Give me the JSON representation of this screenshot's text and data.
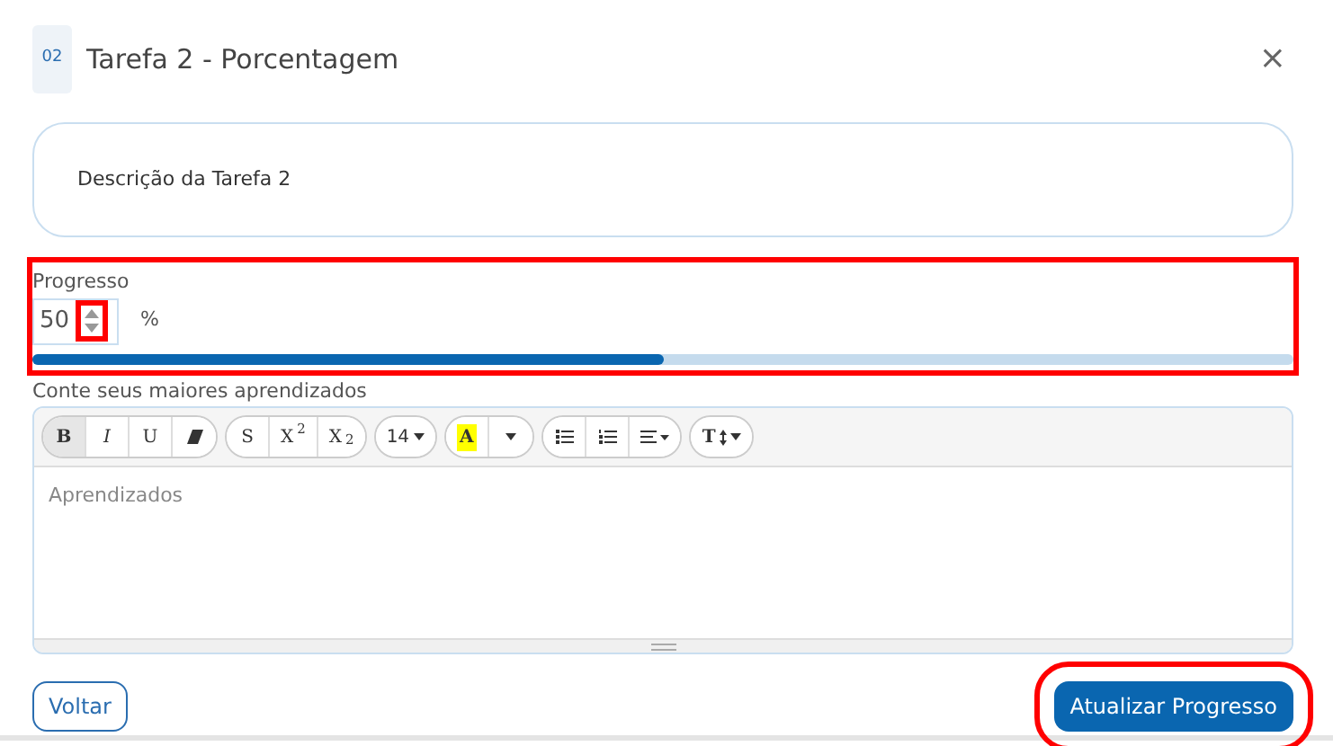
{
  "header": {
    "number": "02",
    "title": "Tarefa 2 - Porcentagem",
    "close": "×"
  },
  "description": "Descrição da Tarefa 2",
  "progress": {
    "label": "Progresso",
    "value": "50",
    "unit": "%",
    "level": 0.5,
    "highlighted": true,
    "spinner_highlighted": true
  },
  "learnings": {
    "label": "Conte seus maiores aprendizados",
    "placeholder": "Aprendizados",
    "toolbar": [
      [
        {
          "kind": "text",
          "label": "**B**",
          "selected": true
        },
        {
          "kind": "text",
          "label": "*I*",
          "selected": false
        },
        {
          "kind": "text",
          "label": "U",
          "selected": false
        },
        {
          "kind": "eraser",
          "selected": false
        }
      ],
      [
        {
          "kind": "text",
          "label": "S",
          "selected": false
        },
        {
          "kind": "text",
          "label": "X$^{2}$",
          "selected": false
        },
        {
          "kind": "text",
          "label": "X$_{2}$",
          "selected": false
        }
      ],
      [
        {
          "kind": "dropdown",
          "label": "14",
          "selected": false
        }
      ],
      [
        {
          "kind": "highlight",
          "label": "A",
          "selected": false
        },
        {
          "kind": "caret",
          "selected": false
        }
      ],
      [
        {
          "kind": "bullets",
          "selected": false
        },
        {
          "kind": "numbers",
          "selected": false
        },
        {
          "kind": "align",
          "selected": false
        }
      ],
      [
        {
          "kind": "lineheight",
          "label": "T",
          "selected": false
        }
      ]
    ]
  },
  "buttons": [
    {
      "label": "Voltar",
      "kind": "outline",
      "highlighted": false
    },
    {
      "label": "Atualizar Progresso",
      "kind": "primary",
      "highlighted": true
    }
  ]
}
